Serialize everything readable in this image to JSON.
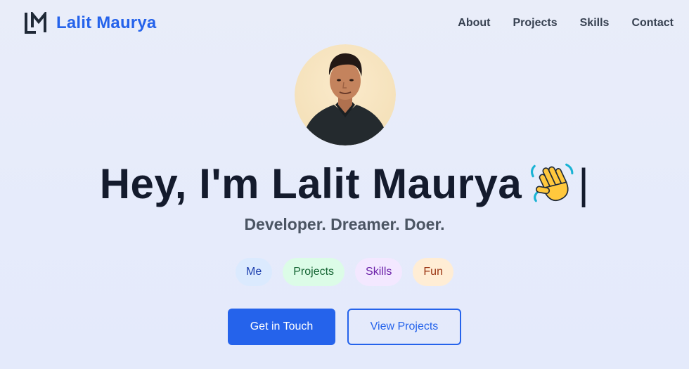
{
  "header": {
    "brand_name": "Lalit Maurya",
    "logo_icon": "lm-monogram-icon",
    "nav": [
      "About",
      "Projects",
      "Skills",
      "Contact"
    ]
  },
  "hero": {
    "avatar": "profile-photo",
    "title": "Hey, I'm Lalit Maurya",
    "emoji": "waving-hand-icon",
    "cursor": "|",
    "tagline": "Developer. Dreamer. Doer."
  },
  "chips": [
    {
      "label": "Me",
      "bg": "#dbeafe",
      "color": "#1e40af"
    },
    {
      "label": "Projects",
      "bg": "#dcfce7",
      "color": "#166534"
    },
    {
      "label": "Skills",
      "bg": "#f3e8ff",
      "color": "#6b21a8"
    },
    {
      "label": "Fun",
      "bg": "#ffedd5",
      "color": "#9a3412"
    }
  ],
  "buttons": {
    "primary": "Get in Touch",
    "secondary": "View Projects"
  },
  "colors": {
    "accent": "#2563eb",
    "background": "#e9edf9",
    "heading": "#141b2d"
  }
}
